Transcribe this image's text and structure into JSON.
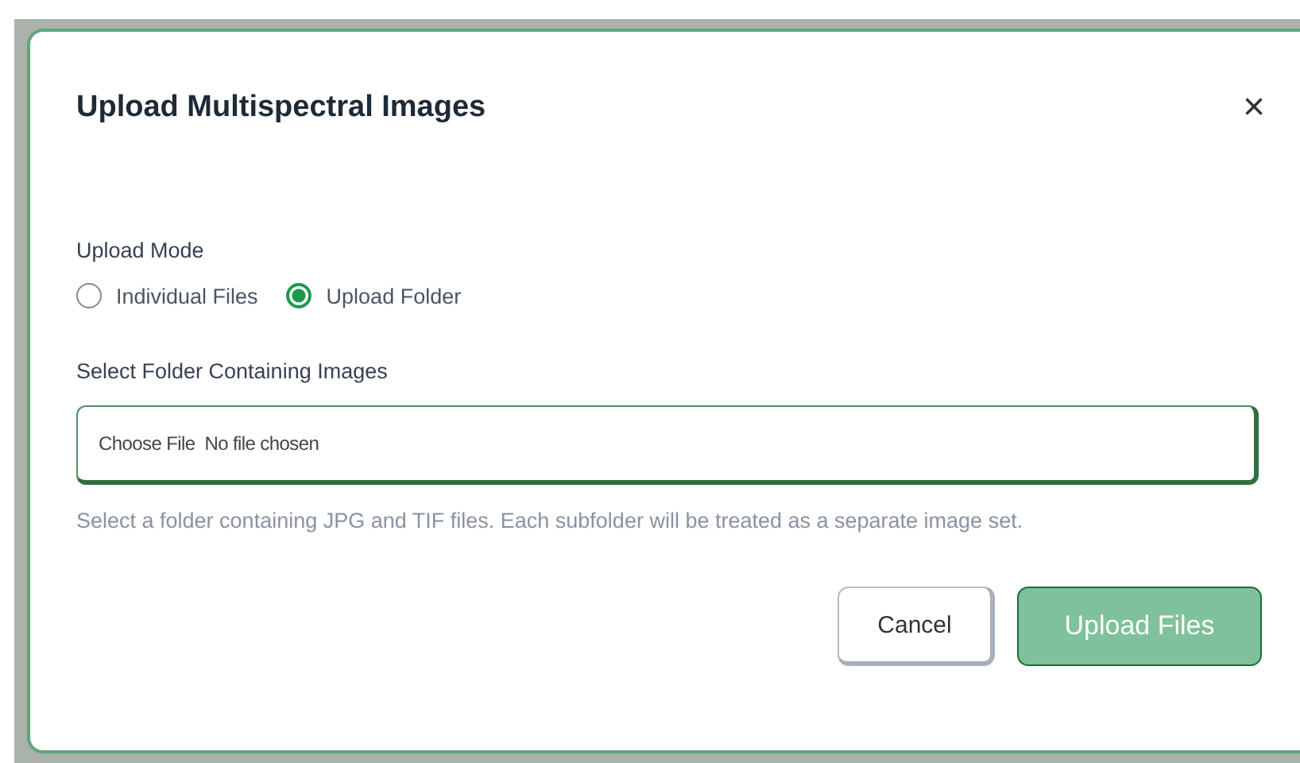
{
  "dialog": {
    "title": "Upload Multispectral Images",
    "close": "×"
  },
  "upload_mode": {
    "label": "Upload Mode",
    "options": [
      {
        "label": "Individual Files",
        "selected": false
      },
      {
        "label": "Upload Folder",
        "selected": true
      }
    ]
  },
  "folder_field": {
    "label": "Select Folder Containing Images",
    "button": "Choose File",
    "status": "No file chosen",
    "help": "Select a folder containing JPG and TIF files. Each subfolder will be treated as a separate image set."
  },
  "buttons": [
    {
      "label": "Cancel",
      "kind": "secondary",
      "disabled": false
    },
    {
      "label": "Upload Files",
      "kind": "primary",
      "disabled": true
    }
  ]
}
